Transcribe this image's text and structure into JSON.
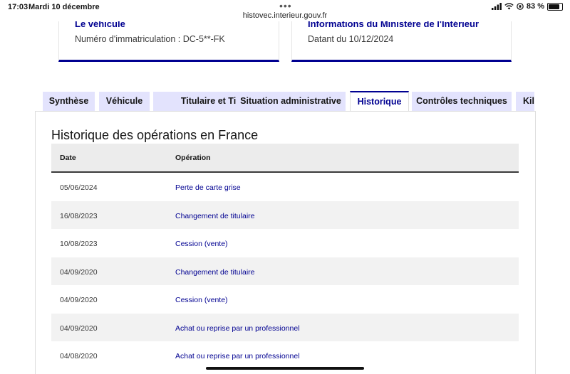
{
  "status_bar": {
    "time": "17:03",
    "date": "Mardi 10 décembre",
    "url": "histovec.interieur.gouv.fr",
    "battery": "83 %",
    "battery_level": 0.83,
    "dots_icon": "more-dots"
  },
  "cards": {
    "vehicle": {
      "title": "Le véhicule",
      "text": "Numéro d'immatriculation : DC-5**-FK"
    },
    "ministry": {
      "title": "Informations du Ministère de l'Intérieur",
      "text": "Datant du 10/12/2024"
    }
  },
  "tabs": [
    {
      "label": "Synthèse"
    },
    {
      "label": "Véhicule"
    },
    {
      "label": "Titulaire et Titre"
    },
    {
      "label": "Situation administrative"
    },
    {
      "label": "Historique",
      "active": true
    },
    {
      "label": "Contrôles techniques"
    },
    {
      "label": "Kil"
    }
  ],
  "history": {
    "title": "Historique des opérations en France",
    "headers": {
      "date": "Date",
      "operation": "Opération"
    },
    "rows": [
      {
        "date": "05/06/2024",
        "operation": "Perte de carte grise"
      },
      {
        "date": "16/08/2023",
        "operation": "Changement de titulaire"
      },
      {
        "date": "10/08/2023",
        "operation": "Cession (vente)"
      },
      {
        "date": "04/09/2020",
        "operation": "Changement de titulaire"
      },
      {
        "date": "04/09/2020",
        "operation": "Cession (vente)"
      },
      {
        "date": "04/09/2020",
        "operation": "Achat ou reprise par un professionnel"
      },
      {
        "date": "04/08/2020",
        "operation": "Achat ou reprise par un professionnel"
      }
    ]
  },
  "colors": {
    "accent": "#000091",
    "tab_inactive": "#e3e3fd",
    "row_alt": "#f2f2f2",
    "header_bg": "#ececec"
  }
}
